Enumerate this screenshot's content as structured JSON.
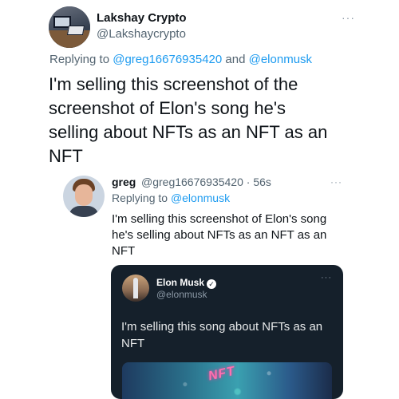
{
  "outer_tweet": {
    "name": "Lakshay Crypto",
    "handle": "@Lakshaycrypto",
    "replying_prefix": "Replying to ",
    "replying_user1": "@greg16676935420",
    "replying_and": " and ",
    "replying_user2": "@elonmusk",
    "text": "I'm selling this screenshot of the screenshot of Elon's song he's selling about NFTs as an NFT as an NFT",
    "more": "···"
  },
  "quoted_tweet": {
    "name": "greg",
    "handle_time": "@greg16676935420 · 56s",
    "replying_prefix": "Replying to ",
    "replying_user": "@elonmusk",
    "text": "I'm selling this screenshot of Elon's song he's selling about NFTs as an NFT as an NFT",
    "more": "···"
  },
  "embedded_tweet": {
    "name": "Elon Musk",
    "verified": "✓",
    "handle": "@elonmusk",
    "text": "I'm selling this song about NFTs as an NFT",
    "media_label": "NFT",
    "more": "···"
  },
  "colors": {
    "link": "#1d9bf0",
    "card_background": "#15202b",
    "secondary_text": "#536471"
  }
}
